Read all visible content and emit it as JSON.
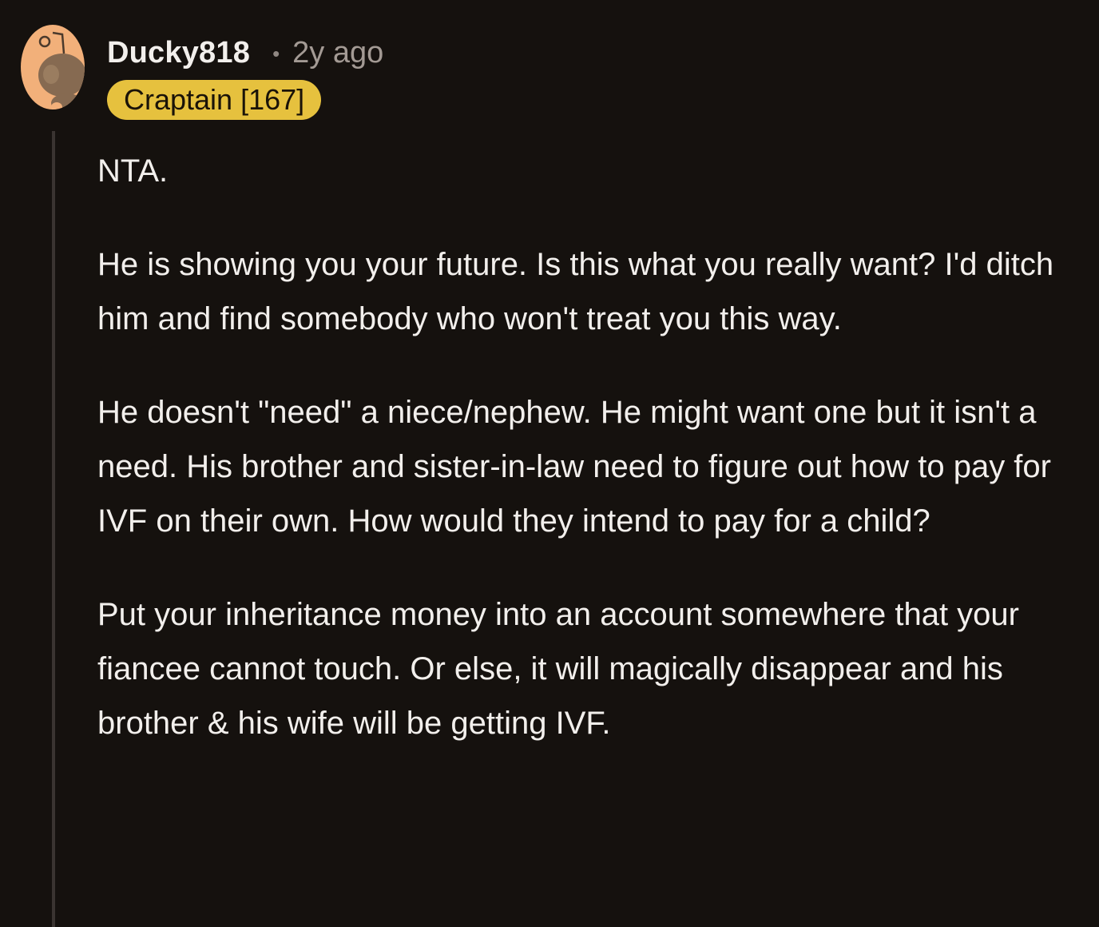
{
  "comment": {
    "author": "Ducky818",
    "separator": "•",
    "timestamp": "2y ago",
    "flair": "Craptain [167]",
    "avatar_icon": "snoo-avatar-icon",
    "colors": {
      "background": "#15110e",
      "flair_background": "#e6c13e",
      "avatar_background": "#f2b07a",
      "thread_line": "#3a3431"
    },
    "paragraphs": [
      "NTA.",
      "He is showing you your future. Is this what you really want? I'd ditch him and find somebody who won't treat you this way.",
      "He doesn't \"need\" a niece/nephew. He might want one but it isn't a need. His brother and sister-in-law need to figure out how to pay for IVF on their own. How would they intend to pay for a child?",
      "Put your inheritance money into an account somewhere that your fiancee cannot touch. Or else, it will magically disappear and his brother & his wife will be getting IVF."
    ]
  }
}
